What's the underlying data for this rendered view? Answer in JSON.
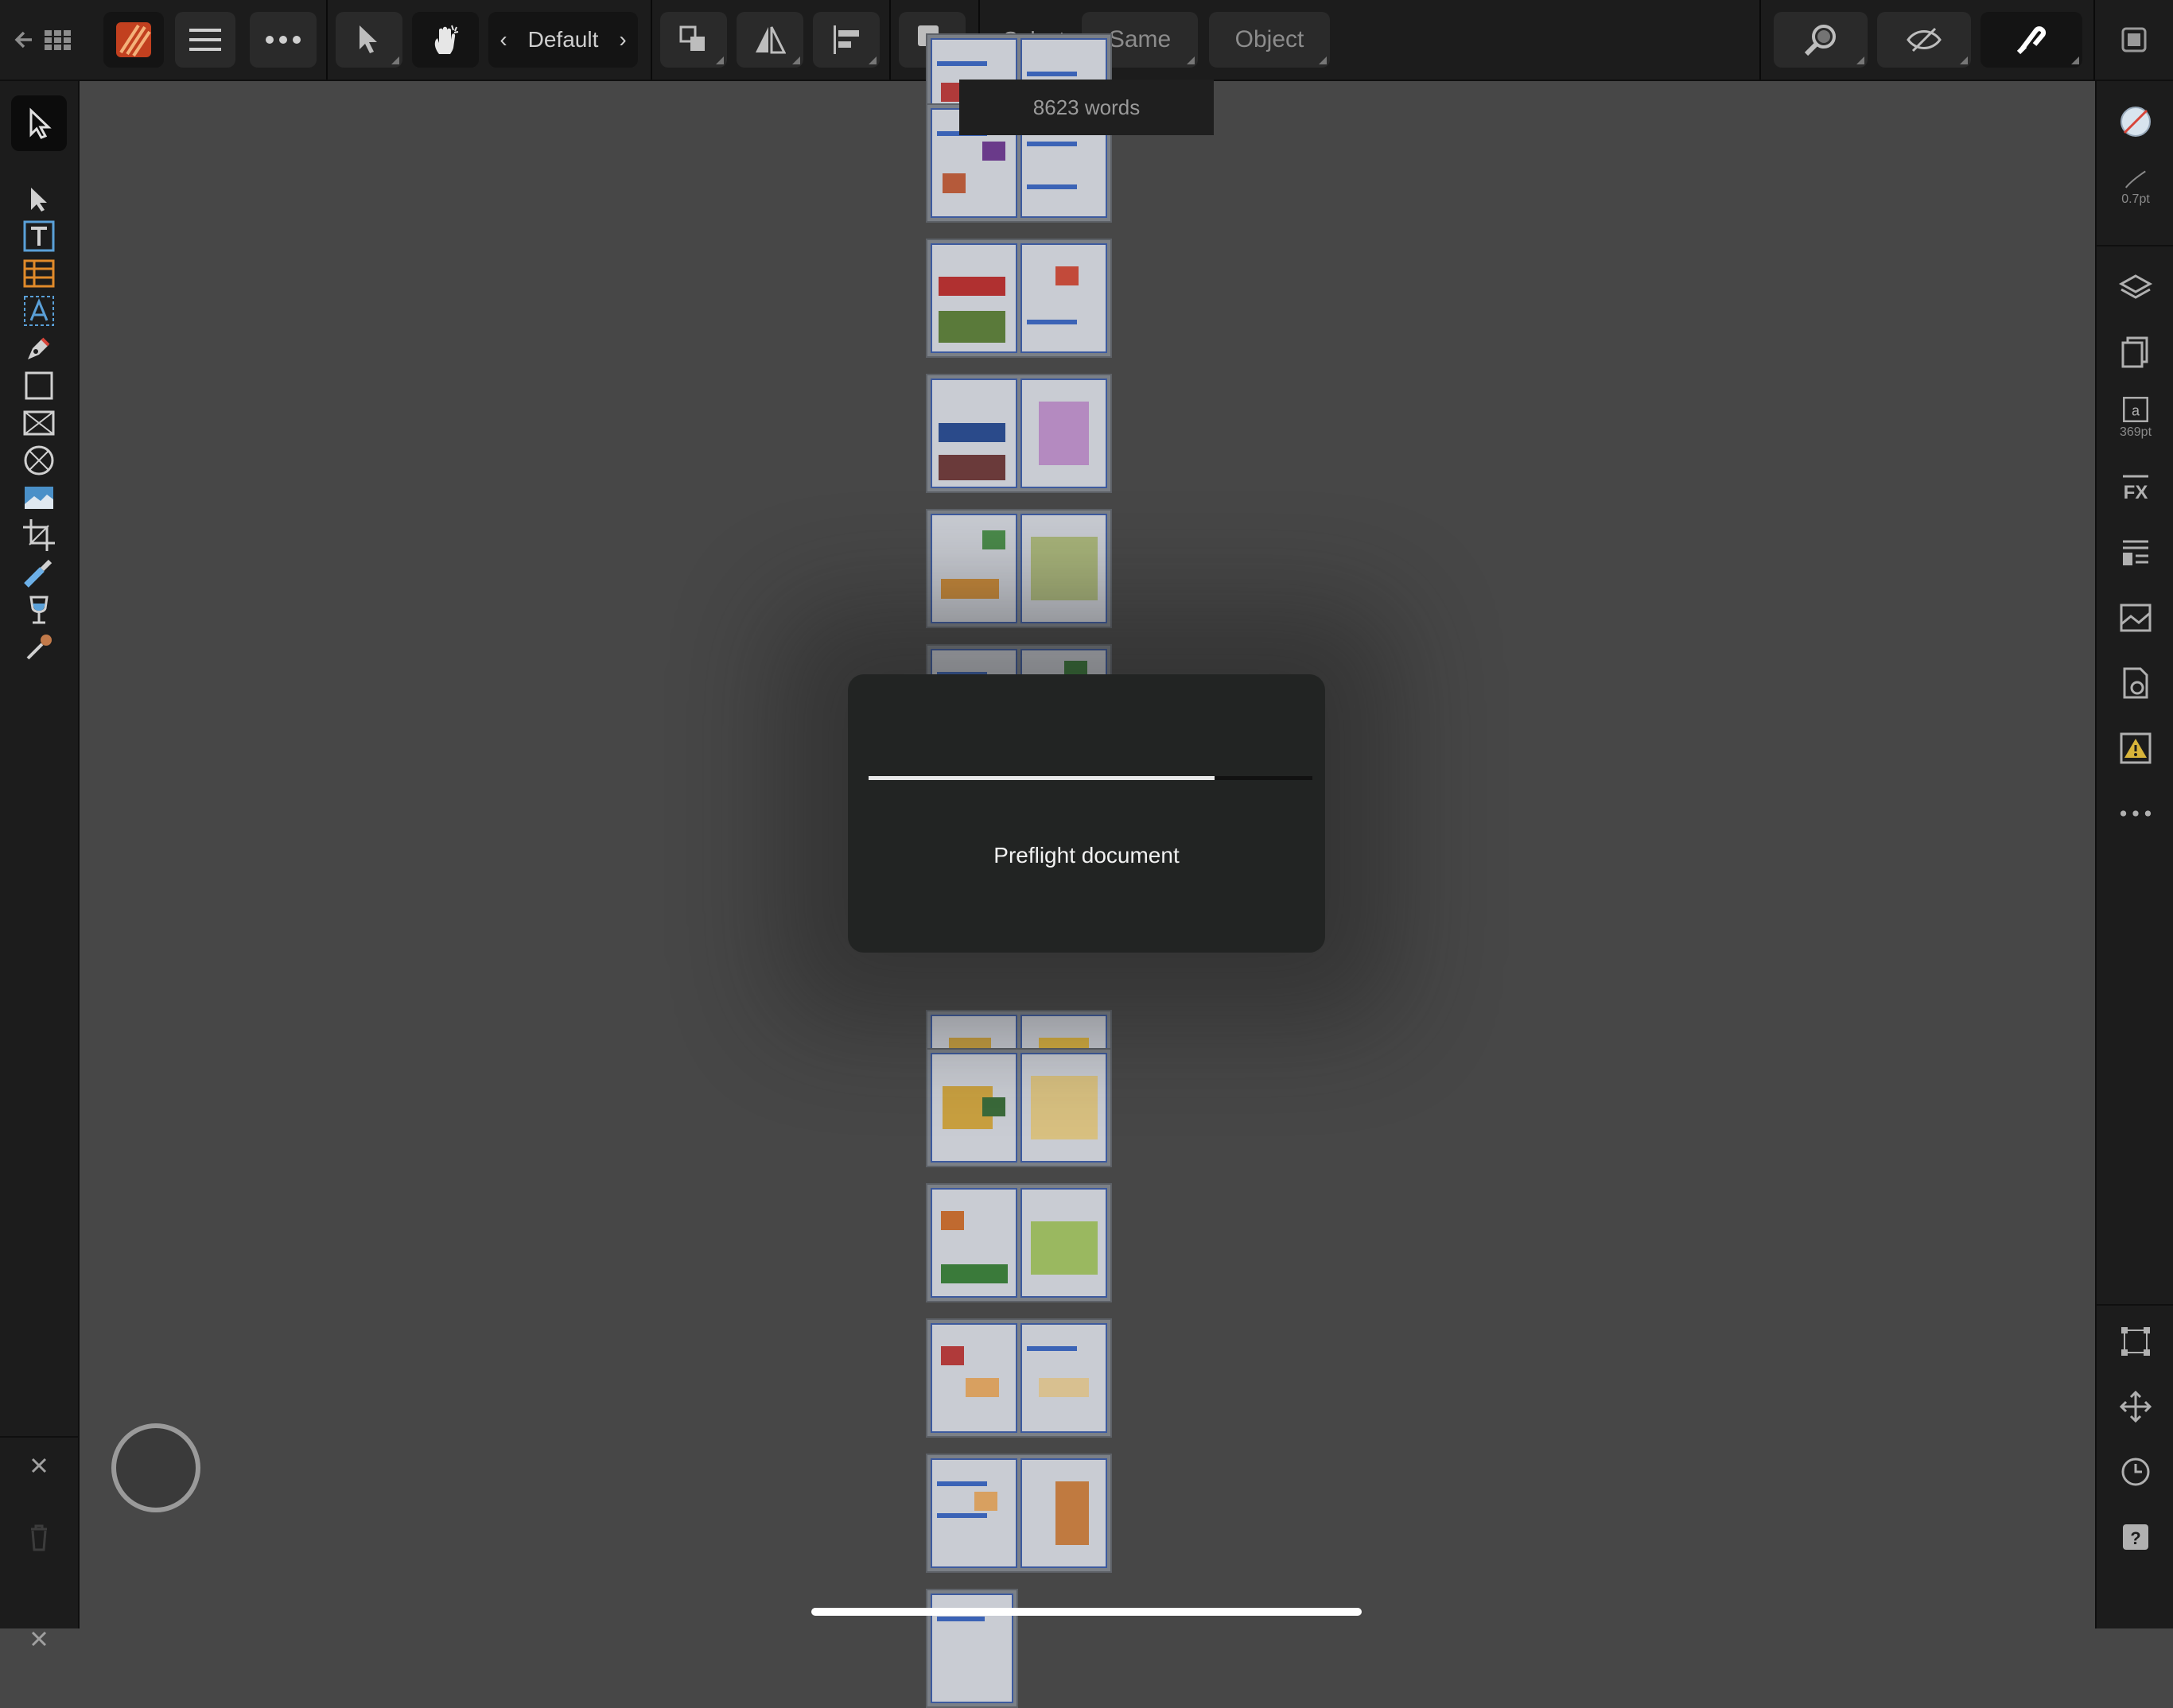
{
  "toolbar": {
    "back_icon": "back-grid-icon",
    "persona_icon": "publisher-persona-icon",
    "menu_icon": "hamburger-menu-icon",
    "more_icon": "ellipsis-icon",
    "preset_label": "Default",
    "select_label": "Select",
    "same_label": "Same",
    "object_label": "Object"
  },
  "word_count": "8623 words",
  "dialog": {
    "message": "Preflight document",
    "progress": 0.78
  },
  "right_panel": {
    "stroke_width": "0.7pt",
    "text_size": "369pt"
  },
  "colors": {
    "persona_accent": "#c2401f",
    "warning": "#d8b43a"
  }
}
